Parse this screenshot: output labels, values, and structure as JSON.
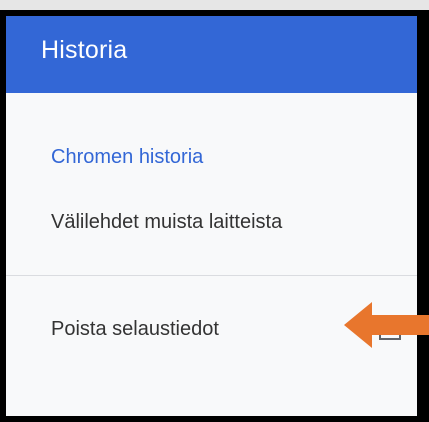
{
  "header": {
    "title": "Historia"
  },
  "menu": {
    "items": [
      {
        "label": "Chromen historia",
        "active": true
      },
      {
        "label": "Välilehdet muista laitteista",
        "active": false
      },
      {
        "label": "Poista selaustiedot",
        "active": false
      }
    ]
  },
  "icons": {
    "open_in_new": "open-in-new-icon",
    "annotation_arrow": "arrow-left-icon"
  },
  "colors": {
    "header_bg": "#3367d6",
    "active_text": "#3367d6",
    "arrow": "#e8762d"
  }
}
